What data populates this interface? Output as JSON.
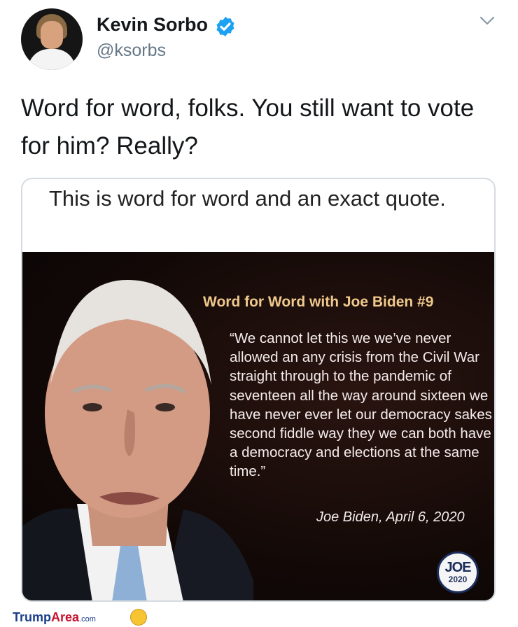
{
  "header": {
    "display_name": "Kevin Sorbo",
    "handle": "@ksorbs",
    "verified": true,
    "icons": [
      "avatar",
      "verified-badge-icon",
      "chevron-down-icon"
    ]
  },
  "tweet": {
    "text": "Word for word, folks.  You still want to vote for him? Really?"
  },
  "card": {
    "caption": "This is word for word and an exact quote.",
    "meme": {
      "title": "Word for Word with Joe Biden #9",
      "quote": "“We cannot let this we we’ve never allowed an any crisis from the Civil War straight through to the pandemic of seventeen all the way around sixteen we have never ever let our democracy sakes second fiddle way they we can both have a democracy and elections at the same time.”",
      "attribution": "Joe Biden, April 6, 2020",
      "logo_top": "JOE",
      "logo_bottom": "2020"
    }
  },
  "footer": {
    "brand_part1": "Trump",
    "brand_part2": "Area",
    "brand_part3": ".com"
  },
  "colors": {
    "verified": "#1da1f2",
    "handle": "#657786",
    "meme_title": "#f0c98c",
    "logo_navy": "#1b2d5b"
  }
}
